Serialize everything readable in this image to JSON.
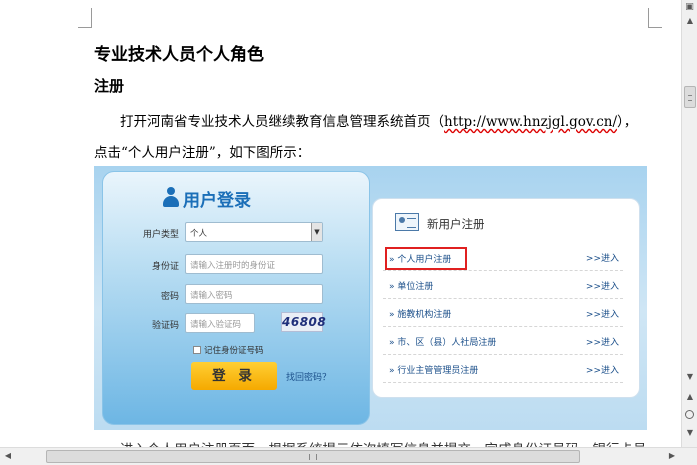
{
  "document": {
    "title": "专业技术人员个人角色",
    "heading": "注册",
    "line1_prefix": "打开河南省专业技术人员继续教育信息管理系统首页（",
    "line1_link": "http://www.hnzjgl.gov.cn/",
    "line1_suffix": "），",
    "line2": "点击“个人用户注册”，如下图所示：",
    "line3": "进入个人用户注册页面，根据系统提示依次填写信息并提交，完成身份证号码、银行卡号..."
  },
  "login": {
    "title": "用户登录",
    "fields": [
      {
        "label": "用户类型",
        "value": "个人",
        "placeholder": ""
      },
      {
        "label": "身份证",
        "value": "",
        "placeholder": "请输入注册时的身份证"
      },
      {
        "label": "密码",
        "value": "",
        "placeholder": "请输入密码"
      },
      {
        "label": "验证码",
        "value": "",
        "placeholder": "请输入验证码"
      }
    ],
    "captcha": "46808",
    "remember": "记住身份证号码",
    "login_button": "登 录",
    "forgot": "找回密码？"
  },
  "registration": {
    "title": "新用户注册",
    "items": [
      {
        "label": "» 个人用户注册",
        "enter": ">>进入"
      },
      {
        "label": "» 单位注册",
        "enter": ">>进入"
      },
      {
        "label": "» 施教机构注册",
        "enter": ">>进入"
      },
      {
        "label": "» 市、区（县）人社局注册",
        "enter": ">>进入"
      },
      {
        "label": "» 行业主管管理员注册",
        "enter": ">>进入"
      }
    ]
  },
  "scrollbars": {
    "hscroll_grip": "III"
  },
  "colors": {
    "accent_blue": "#1b6fb8",
    "login_button": "#f5a900",
    "highlight_box": "#e02020"
  }
}
